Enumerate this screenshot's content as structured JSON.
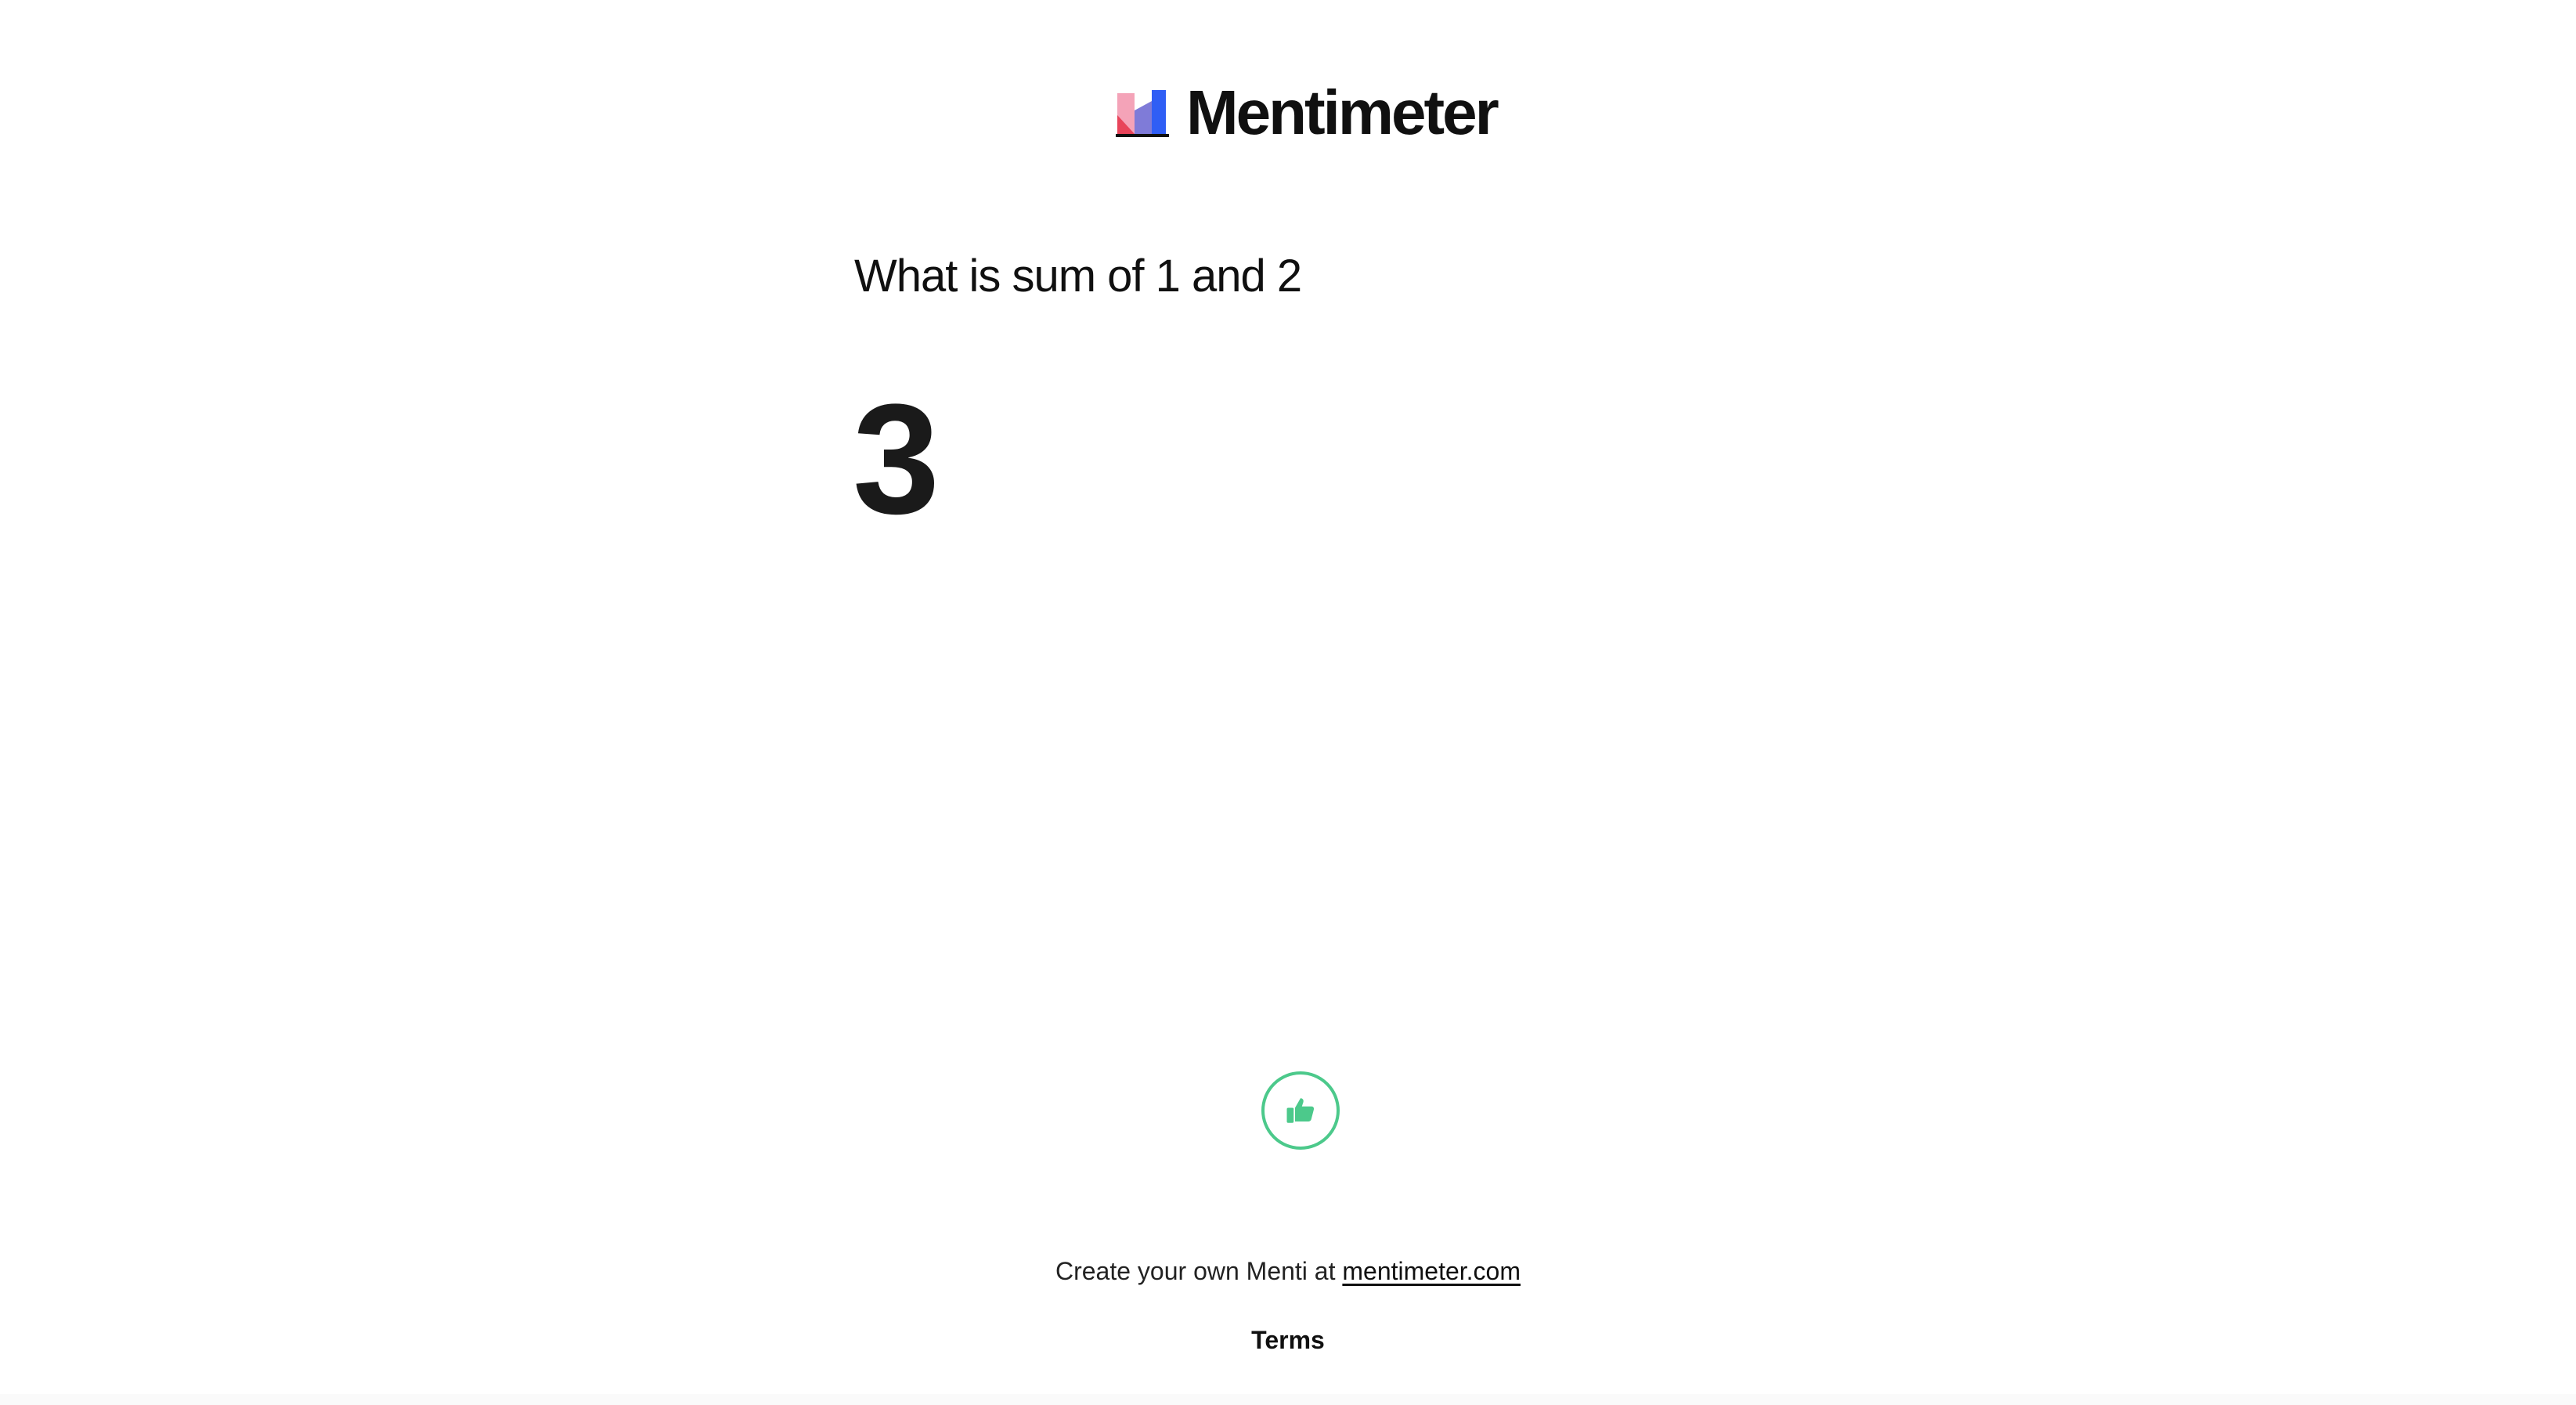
{
  "brand": {
    "name": "Mentimeter",
    "colors": {
      "pink": "#f4a3b8",
      "red": "#e8445a",
      "blue": "#2f5ef5",
      "black": "#101010"
    }
  },
  "question": {
    "text": "What is sum of 1 and 2"
  },
  "answer": {
    "value": "3"
  },
  "reaction": {
    "icon": "thumbs-up-icon",
    "color": "#4cc98b"
  },
  "footer": {
    "prefix": "Create your own Menti at",
    "link_label": "mentimeter.com",
    "terms_label": "Terms"
  }
}
